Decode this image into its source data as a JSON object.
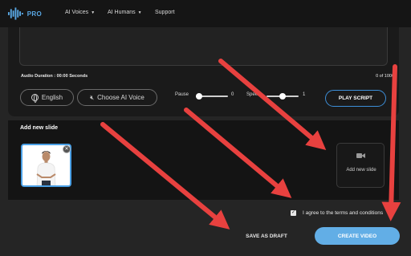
{
  "nav": {
    "brand": "PRO",
    "items": [
      {
        "label": "AI Voices",
        "has_caret": true
      },
      {
        "label": "AI Humans",
        "has_caret": true
      },
      {
        "label": "Support",
        "has_caret": false
      }
    ]
  },
  "script_panel": {
    "audio_duration": "Audio Duration : 00:00 Seconds",
    "char_count": "0 of 1000",
    "language_label": "English",
    "voice_label": "Choose AI Voice",
    "pause_label": "Pause",
    "pause_value": "0",
    "speed_label": "Speed",
    "speed_value": "1",
    "play_label": "PLAY SCRIPT"
  },
  "slides": {
    "title": "Add new slide",
    "close_glyph": "✕",
    "add_label": "Add new slide"
  },
  "footer": {
    "terms_label": "I agree to the terms and conditions",
    "terms_checked": true,
    "checkmark": "✓",
    "draft_label": "SAVE AS DRAFT",
    "create_label": "CREATE VIDEO"
  },
  "icons": [
    "logo-waveform-icon",
    "chevron-down-icon",
    "globe-icon",
    "mute-icon",
    "video-camera-icon",
    "close-icon",
    "checkbox-check-icon",
    "annotation-arrow"
  ],
  "colors": {
    "accent": "#3d8fd9",
    "create_button": "#62aee6",
    "annotation_arrows": "#e8413f",
    "background": "#252525"
  }
}
